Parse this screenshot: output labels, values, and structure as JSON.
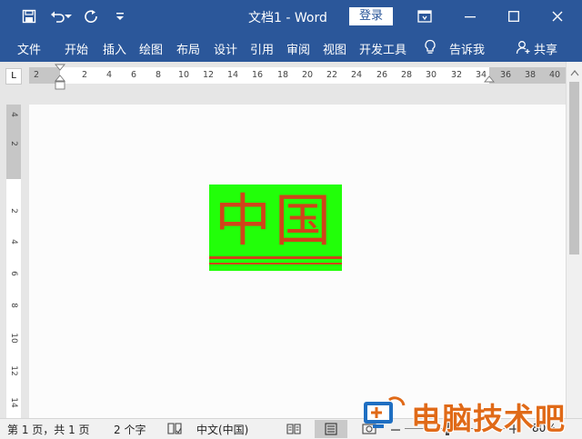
{
  "titlebar": {
    "document_name": "文档1",
    "separator": " - ",
    "app_name": "Word",
    "login_label": "登录",
    "icons": [
      "save-icon",
      "undo-icon",
      "redo-icon",
      "customize-qat-icon",
      "ribbon-display-icon",
      "minimize-icon",
      "maximize-icon",
      "close-icon"
    ]
  },
  "ribbon": {
    "tabs": [
      "文件",
      "开始",
      "插入",
      "绘图",
      "布局",
      "设计",
      "引用",
      "审阅",
      "视图",
      "开发工具"
    ],
    "tell_me": "告诉我",
    "share": "共享"
  },
  "ruler": {
    "corner_symbol": "L",
    "horizontal_ticks": [
      "2",
      "2",
      "4",
      "6",
      "8",
      "10",
      "12",
      "14",
      "16",
      "18",
      "20",
      "22",
      "24",
      "26",
      "28",
      "30",
      "32",
      "34",
      "36",
      "38",
      "40"
    ],
    "vertical_ticks": [
      "4",
      "2",
      "2",
      "4",
      "6",
      "8",
      "10",
      "12",
      "14"
    ]
  },
  "document": {
    "image_text": "中国",
    "colors": {
      "image_background": "#22ff09",
      "image_text": "#d0441a",
      "title_bar": "#2b579a"
    }
  },
  "statusbar": {
    "page_info": "第 1 页，共 1 页",
    "word_count": "2 个字",
    "language": "中文(中国)",
    "zoom": "80%"
  },
  "watermark": {
    "text": "电脑技术吧"
  }
}
